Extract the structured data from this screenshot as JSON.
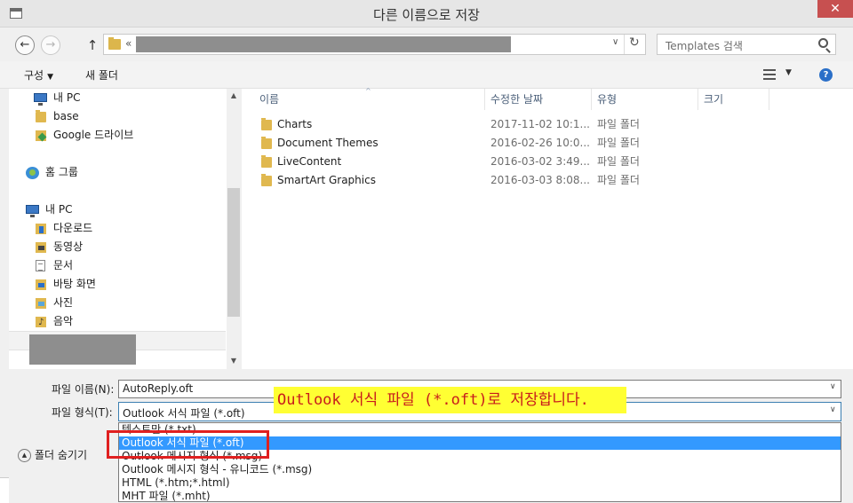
{
  "window": {
    "title": "다른 이름으로 저장",
    "close_label": "✕"
  },
  "nav": {
    "back_label": "←",
    "forward_label": "→",
    "up_label": "↑"
  },
  "address": {
    "prefix": "«",
    "dropdown": "∨",
    "refresh": "↻"
  },
  "search": {
    "placeholder": "Templates 검색"
  },
  "toolbar": {
    "organize_label": "구성",
    "organize_caret": "▼",
    "new_folder_label": "새 폴더",
    "view_caret": "▼",
    "help_label": "?"
  },
  "sidebar": {
    "items": [
      {
        "label": "내 PC",
        "icon": "pc-icon"
      },
      {
        "label": "base",
        "icon": "folder-icon"
      },
      {
        "label": "Google 드라이브",
        "icon": "gdrive-icon"
      },
      {
        "label": "홈 그룹",
        "icon": "homegroup-icon"
      },
      {
        "label": "내 PC",
        "icon": "pc-icon"
      },
      {
        "label": "다운로드",
        "icon": "downloads-icon"
      },
      {
        "label": "동영상",
        "icon": "videos-icon"
      },
      {
        "label": "문서",
        "icon": "documents-icon"
      },
      {
        "label": "바탕 화면",
        "icon": "desktop-icon"
      },
      {
        "label": "사진",
        "icon": "pictures-icon"
      },
      {
        "label": "음악",
        "icon": "music-icon"
      }
    ]
  },
  "file_list": {
    "columns": {
      "name": "이름",
      "date": "수정한 날짜",
      "type": "유형",
      "size": "크기"
    },
    "rows": [
      {
        "name": "Charts",
        "date": "2017-11-02 10:1...",
        "type": "파일 폴더"
      },
      {
        "name": "Document Themes",
        "date": "2016-02-26 10:0...",
        "type": "파일 폴더"
      },
      {
        "name": "LiveContent",
        "date": "2016-03-02 3:49...",
        "type": "파일 폴더"
      },
      {
        "name": "SmartArt Graphics",
        "date": "2016-03-03 8:08...",
        "type": "파일 폴더"
      }
    ]
  },
  "save": {
    "filename_label": "파일 이름(N):",
    "filename_value": "AutoReply.oft",
    "filetype_label": "파일 형식(T):",
    "filetype_value": "Outlook 서식 파일 (*.oft)",
    "dropdown_arrow": "∨",
    "filetype_options": [
      "텍스트만 (*.txt)",
      "Outlook 서식 파일 (*.oft)",
      "Outlook 메시지 형식 (*.msg)",
      "Outlook 메시지 형식 - 유니코드 (*.msg)",
      "HTML (*.htm;*.html)",
      "MHT 파일 (*.mht)"
    ],
    "hide_folders_label": "폴더 숨기기",
    "hide_folders_glyph": "▲"
  },
  "annotation": {
    "callout_text": "Outlook 서식 파일 (*.oft)로 저장합니다.",
    "callout_bg": "#ffff33",
    "callout_color": "#c81c1c",
    "box_color": "#e02020"
  }
}
